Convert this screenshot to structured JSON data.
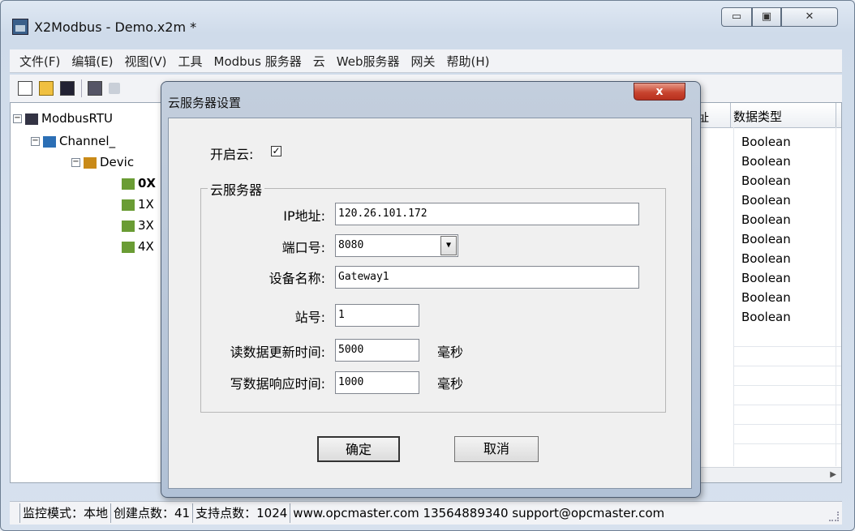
{
  "window": {
    "title": "X2Modbus - Demo.x2m *",
    "controls": {
      "minimize": "▭",
      "maximize": "▣",
      "close": "✕"
    }
  },
  "menu": [
    "文件(F)",
    "编辑(E)",
    "视图(V)",
    "工具",
    "Modbus 服务器",
    "云",
    "Web服务器",
    "网关",
    "帮助(H)"
  ],
  "tree": {
    "root": "ModbusRTU",
    "channel": "Channel_",
    "device": "Devic",
    "items": [
      "0X",
      "1X",
      "3X",
      "4X"
    ]
  },
  "grid": {
    "col_address_partial": "址",
    "col_type": "数据类型",
    "rows": [
      "Boolean",
      "Boolean",
      "Boolean",
      "Boolean",
      "Boolean",
      "Boolean",
      "Boolean",
      "Boolean",
      "Boolean",
      "Boolean"
    ]
  },
  "status": {
    "mode": "监控模式：本地",
    "created": "创建点数：41",
    "supported": "支持点数：1024",
    "contact": "www.opcmaster.com 13564889340 support@opcmaster.com"
  },
  "dialog": {
    "title": "云服务器设置",
    "close_label": "x",
    "enable_label": "开启云:",
    "enable_checked": true,
    "group_title": "云服务器",
    "fields": {
      "ip_label": "IP地址:",
      "ip_value": "120.26.101.172",
      "port_label": "端口号:",
      "port_value": "8080",
      "device_name_label": "设备名称:",
      "device_name_value": "Gateway1",
      "station_label": "站号:",
      "station_value": "1",
      "read_interval_label": "读数据更新时间:",
      "read_interval_value": "5000",
      "read_unit": "毫秒",
      "write_timeout_label": "写数据响应时间:",
      "write_timeout_value": "1000",
      "write_unit": "毫秒"
    },
    "ok_label": "确定",
    "cancel_label": "取消"
  }
}
